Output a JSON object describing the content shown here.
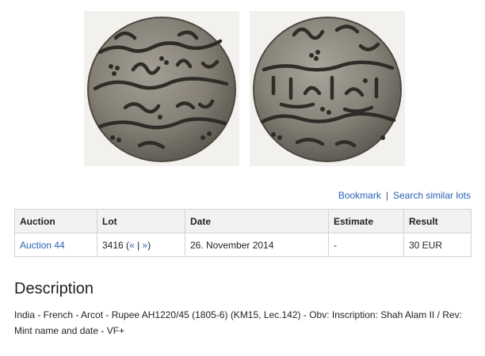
{
  "actions": {
    "bookmark": "Bookmark",
    "separator": "|",
    "search_similar": "Search similar lots"
  },
  "table": {
    "headers": [
      "Auction",
      "Lot",
      "Date",
      "Estimate",
      "Result"
    ],
    "row": {
      "auction": "Auction 44",
      "lot_number": "3416",
      "lot_open": "(",
      "prev_nav": "«",
      "nav_sep": "|",
      "next_nav": "»",
      "lot_close": ")",
      "date": "26. November 2014",
      "estimate": "-",
      "result": "30 EUR"
    }
  },
  "description": {
    "title": "Description",
    "text": "India - French - Arcot - Rupee AH1220/45 (1805-6) (KM15, Lec.142) - Obv: Inscription: Shah Alam II / Rev: Mint name and date - VF+"
  },
  "colors": {
    "link": "#2a62b3",
    "header_bg": "#f2f2f2",
    "border": "#d3d3d3",
    "coin_silver": "#8a857c",
    "coin_dark": "#3e3a35"
  }
}
